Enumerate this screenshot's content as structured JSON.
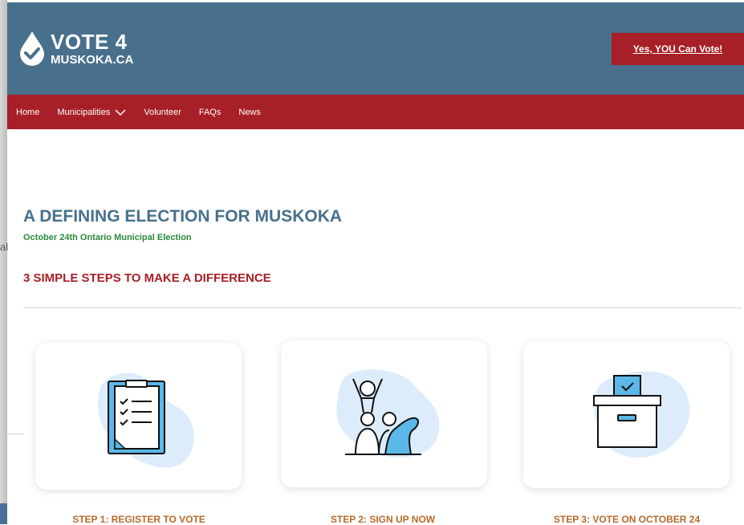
{
  "background": {
    "partial_text": "al"
  },
  "header": {
    "logo_line1": "VOTE 4",
    "logo_line2": "MUSKOKA.CA",
    "cta_label": "Yes, YOU Can Vote!"
  },
  "nav": {
    "items": [
      "Home",
      "Municipalities",
      "Volunteer",
      "FAQs",
      "News"
    ]
  },
  "main": {
    "title": "A DEFINING ELECTION FOR MUSKOKA",
    "subtitle": "October 24th Ontario Municipal Election",
    "section_heading": "3 SIMPLE STEPS TO MAKE A DIFFERENCE",
    "steps": [
      {
        "label": "STEP 1: REGISTER TO VOTE",
        "icon": "clipboard-icon"
      },
      {
        "label": "STEP 2: SIGN UP NOW",
        "icon": "people-cheering-icon"
      },
      {
        "label": "STEP 3: VOTE ON OCTOBER 24",
        "icon": "ballot-box-icon"
      }
    ]
  },
  "colors": {
    "header_bg": "#48708c",
    "nav_bg": "#a71f27",
    "title": "#48708c",
    "subtitle": "#2a8a3c",
    "section_heading": "#a71f27",
    "step_label": "#b86a2a",
    "icon_blob": "#dcecfb",
    "icon_accent": "#5bb8e8"
  }
}
